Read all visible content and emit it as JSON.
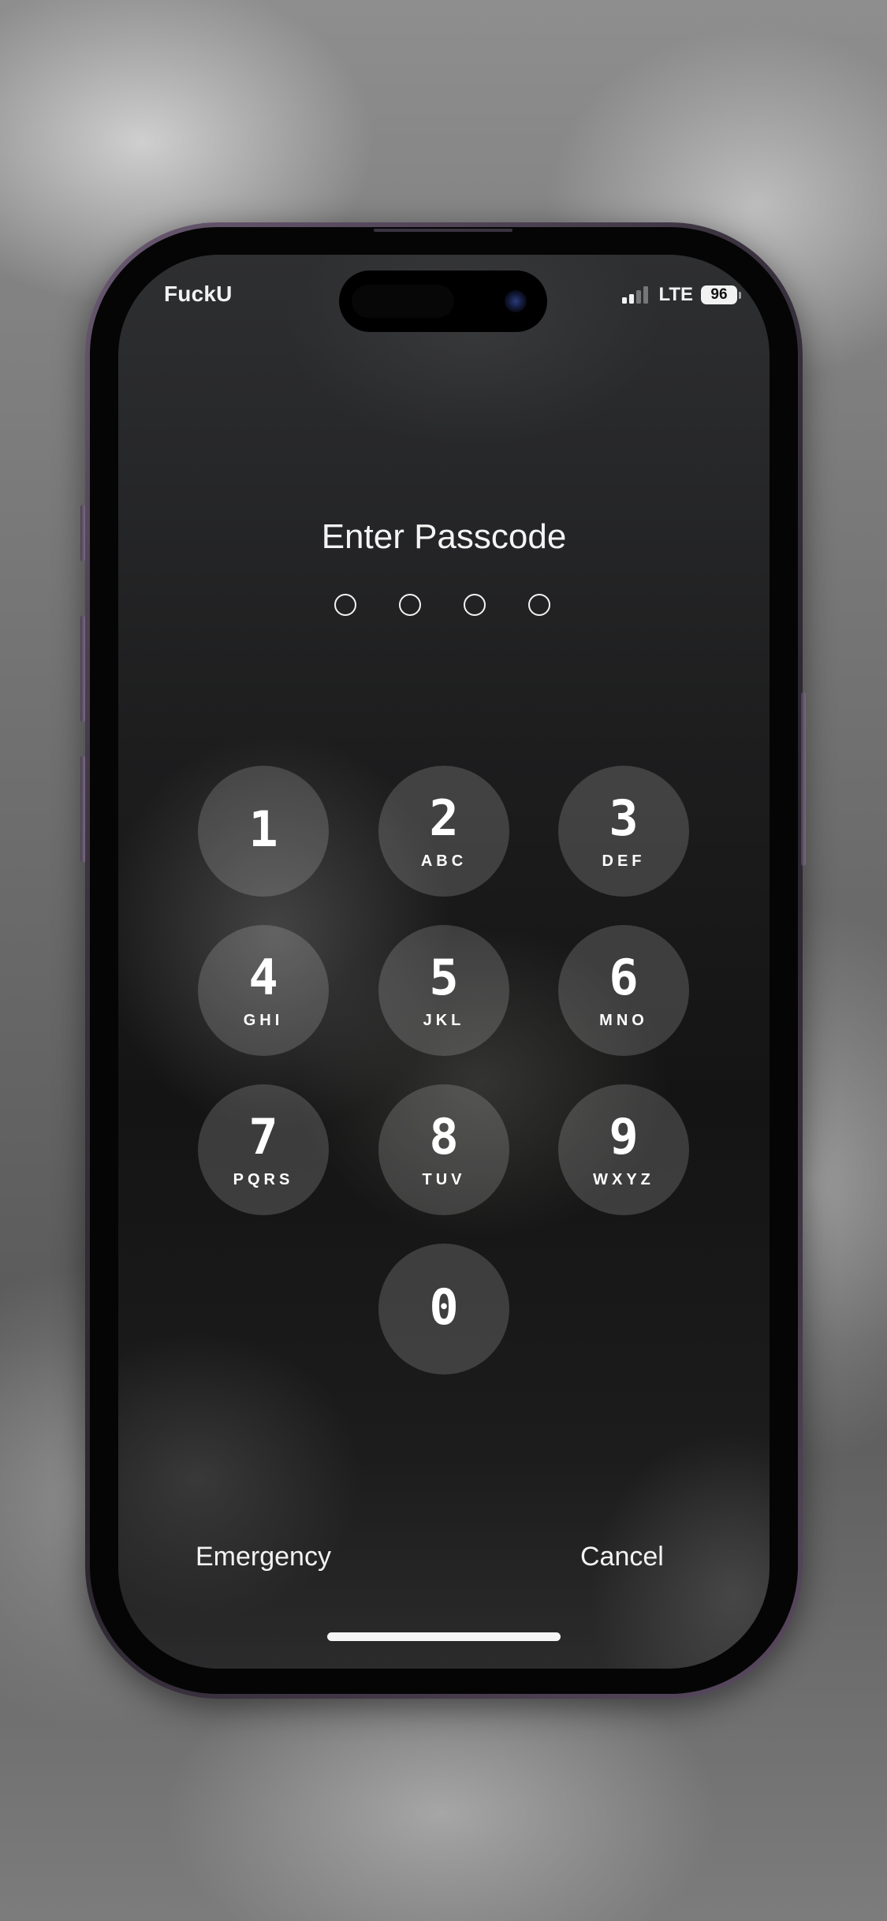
{
  "status_bar": {
    "carrier": "FuckU",
    "network": "LTE",
    "battery_level": "96",
    "signal_bars_active": 2,
    "signal_bars_total": 4
  },
  "passcode": {
    "title": "Enter Passcode",
    "length": 4,
    "entered": 0
  },
  "keypad": [
    {
      "digit": "1",
      "letters": ""
    },
    {
      "digit": "2",
      "letters": "ABC"
    },
    {
      "digit": "3",
      "letters": "DEF"
    },
    {
      "digit": "4",
      "letters": "GHI"
    },
    {
      "digit": "5",
      "letters": "JKL"
    },
    {
      "digit": "6",
      "letters": "MNO"
    },
    {
      "digit": "7",
      "letters": "PQRS"
    },
    {
      "digit": "8",
      "letters": "TUV"
    },
    {
      "digit": "9",
      "letters": "WXYZ"
    },
    {
      "digit": "0",
      "letters": ""
    }
  ],
  "footer": {
    "emergency_label": "Emergency",
    "cancel_label": "Cancel"
  },
  "icons": {
    "signal": "cellular-signal-icon",
    "battery": "battery-icon",
    "camera": "front-camera-icon"
  }
}
